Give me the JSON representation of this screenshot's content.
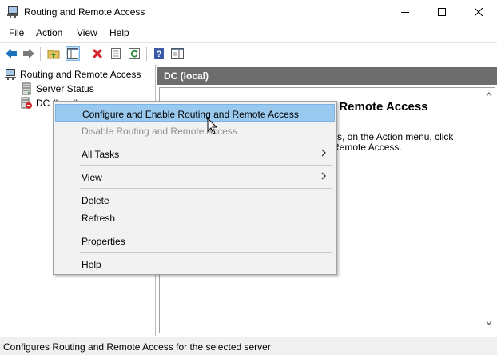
{
  "window": {
    "title": "Routing and Remote Access"
  },
  "menubar": {
    "items": [
      "File",
      "Action",
      "View",
      "Help"
    ]
  },
  "tree": {
    "root": "Routing and Remote Access",
    "server_status": "Server Status",
    "dc_local": "DC (local)"
  },
  "right_pane": {
    "header": "DC (local)",
    "heading_fragment": "l Remote Access",
    "text_line1": "ss, on the Action menu, click",
    "text_line2": "Remote Access."
  },
  "context_menu": {
    "items": [
      {
        "label": "Configure and Enable Routing and Remote Access",
        "state": "highlighted"
      },
      {
        "label": "Disable Routing and Remote Access",
        "state": "disabled"
      },
      {
        "label": "All Tasks",
        "submenu": true
      },
      {
        "label": "View",
        "submenu": true
      },
      {
        "label": "Delete"
      },
      {
        "label": "Refresh"
      },
      {
        "label": "Properties"
      },
      {
        "label": "Help"
      }
    ]
  },
  "statusbar": {
    "text": "Configures Routing and Remote Access for the selected server"
  },
  "colors": {
    "highlight": "#99c9ef",
    "header_bg": "#6d6d6d",
    "delete_red": "#d4252b",
    "nav_blue": "#1e73be"
  }
}
